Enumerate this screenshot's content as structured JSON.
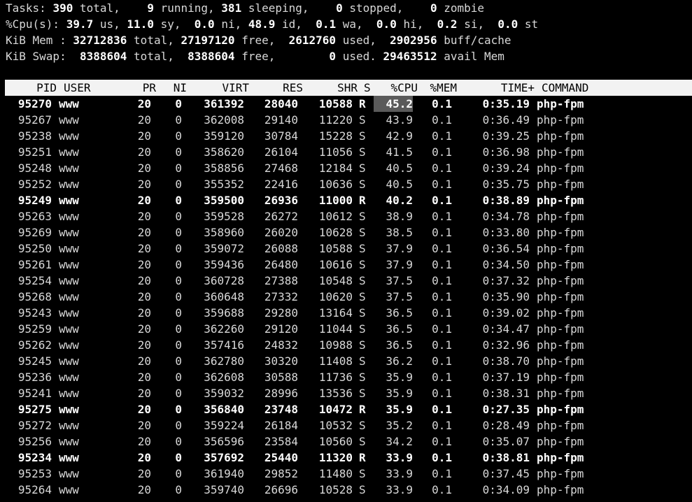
{
  "summary": {
    "tasks": {
      "label": "Tasks:",
      "total": "390",
      "total_label": "total,",
      "running": "9",
      "running_label": "running,",
      "sleeping": "381",
      "sleeping_label": "sleeping,",
      "stopped": "0",
      "stopped_label": "stopped,",
      "zombie": "0",
      "zombie_label": "zombie"
    },
    "cpu": {
      "label": "%Cpu(s):",
      "us": "39.7",
      "us_label": "us,",
      "sy": "11.0",
      "sy_label": "sy,",
      "ni": "0.0",
      "ni_label": "ni,",
      "id": "48.9",
      "id_label": "id,",
      "wa": "0.1",
      "wa_label": "wa,",
      "hi": "0.0",
      "hi_label": "hi,",
      "si": "0.2",
      "si_label": "si,",
      "st": "0.0",
      "st_label": "st"
    },
    "mem": {
      "label": "KiB Mem :",
      "total": "32712836",
      "total_label": "total,",
      "free": "27197120",
      "free_label": "free,",
      "used": "2612760",
      "used_label": "used,",
      "buff": "2902956",
      "buff_label": "buff/cache"
    },
    "swap": {
      "label": "KiB Swap:",
      "total": "8388604",
      "total_label": "total,",
      "free": "8388604",
      "free_label": "free,",
      "used": "0",
      "used_label": "used.",
      "avail": "29463512",
      "avail_label": "avail Mem"
    }
  },
  "columns": [
    "PID",
    "USER",
    "PR",
    "NI",
    "VIRT",
    "RES",
    "SHR",
    "S",
    "%CPU",
    "%MEM",
    "TIME+",
    "COMMAND"
  ],
  "processes": [
    {
      "pid": "95270",
      "user": "www",
      "pr": "20",
      "ni": "0",
      "virt": "361392",
      "res": "28040",
      "shr": "10588",
      "s": "R",
      "cpu": "45.2",
      "mem": "0.1",
      "time": "0:35.19",
      "cmd": "php-fpm",
      "bold": true
    },
    {
      "pid": "95267",
      "user": "www",
      "pr": "20",
      "ni": "0",
      "virt": "362008",
      "res": "29140",
      "shr": "11220",
      "s": "S",
      "cpu": "43.9",
      "mem": "0.1",
      "time": "0:36.49",
      "cmd": "php-fpm",
      "bold": false
    },
    {
      "pid": "95238",
      "user": "www",
      "pr": "20",
      "ni": "0",
      "virt": "359120",
      "res": "30784",
      "shr": "15228",
      "s": "S",
      "cpu": "42.9",
      "mem": "0.1",
      "time": "0:39.25",
      "cmd": "php-fpm",
      "bold": false
    },
    {
      "pid": "95251",
      "user": "www",
      "pr": "20",
      "ni": "0",
      "virt": "358620",
      "res": "26104",
      "shr": "11056",
      "s": "S",
      "cpu": "41.5",
      "mem": "0.1",
      "time": "0:36.98",
      "cmd": "php-fpm",
      "bold": false
    },
    {
      "pid": "95248",
      "user": "www",
      "pr": "20",
      "ni": "0",
      "virt": "358856",
      "res": "27468",
      "shr": "12184",
      "s": "S",
      "cpu": "40.5",
      "mem": "0.1",
      "time": "0:39.24",
      "cmd": "php-fpm",
      "bold": false
    },
    {
      "pid": "95252",
      "user": "www",
      "pr": "20",
      "ni": "0",
      "virt": "355352",
      "res": "22416",
      "shr": "10636",
      "s": "S",
      "cpu": "40.5",
      "mem": "0.1",
      "time": "0:35.75",
      "cmd": "php-fpm",
      "bold": false
    },
    {
      "pid": "95249",
      "user": "www",
      "pr": "20",
      "ni": "0",
      "virt": "359500",
      "res": "26936",
      "shr": "11000",
      "s": "R",
      "cpu": "40.2",
      "mem": "0.1",
      "time": "0:38.89",
      "cmd": "php-fpm",
      "bold": true
    },
    {
      "pid": "95263",
      "user": "www",
      "pr": "20",
      "ni": "0",
      "virt": "359528",
      "res": "26272",
      "shr": "10612",
      "s": "S",
      "cpu": "38.9",
      "mem": "0.1",
      "time": "0:34.78",
      "cmd": "php-fpm",
      "bold": false
    },
    {
      "pid": "95269",
      "user": "www",
      "pr": "20",
      "ni": "0",
      "virt": "358960",
      "res": "26020",
      "shr": "10628",
      "s": "S",
      "cpu": "38.5",
      "mem": "0.1",
      "time": "0:33.80",
      "cmd": "php-fpm",
      "bold": false
    },
    {
      "pid": "95250",
      "user": "www",
      "pr": "20",
      "ni": "0",
      "virt": "359072",
      "res": "26088",
      "shr": "10588",
      "s": "S",
      "cpu": "37.9",
      "mem": "0.1",
      "time": "0:36.54",
      "cmd": "php-fpm",
      "bold": false
    },
    {
      "pid": "95261",
      "user": "www",
      "pr": "20",
      "ni": "0",
      "virt": "359436",
      "res": "26480",
      "shr": "10616",
      "s": "S",
      "cpu": "37.9",
      "mem": "0.1",
      "time": "0:34.50",
      "cmd": "php-fpm",
      "bold": false
    },
    {
      "pid": "95254",
      "user": "www",
      "pr": "20",
      "ni": "0",
      "virt": "360728",
      "res": "27388",
      "shr": "10548",
      "s": "S",
      "cpu": "37.5",
      "mem": "0.1",
      "time": "0:37.32",
      "cmd": "php-fpm",
      "bold": false
    },
    {
      "pid": "95268",
      "user": "www",
      "pr": "20",
      "ni": "0",
      "virt": "360648",
      "res": "27332",
      "shr": "10620",
      "s": "S",
      "cpu": "37.5",
      "mem": "0.1",
      "time": "0:35.90",
      "cmd": "php-fpm",
      "bold": false
    },
    {
      "pid": "95243",
      "user": "www",
      "pr": "20",
      "ni": "0",
      "virt": "359688",
      "res": "29280",
      "shr": "13164",
      "s": "S",
      "cpu": "36.5",
      "mem": "0.1",
      "time": "0:39.02",
      "cmd": "php-fpm",
      "bold": false
    },
    {
      "pid": "95259",
      "user": "www",
      "pr": "20",
      "ni": "0",
      "virt": "362260",
      "res": "29120",
      "shr": "11044",
      "s": "S",
      "cpu": "36.5",
      "mem": "0.1",
      "time": "0:34.47",
      "cmd": "php-fpm",
      "bold": false
    },
    {
      "pid": "95262",
      "user": "www",
      "pr": "20",
      "ni": "0",
      "virt": "357416",
      "res": "24832",
      "shr": "10988",
      "s": "S",
      "cpu": "36.5",
      "mem": "0.1",
      "time": "0:32.96",
      "cmd": "php-fpm",
      "bold": false
    },
    {
      "pid": "95245",
      "user": "www",
      "pr": "20",
      "ni": "0",
      "virt": "362780",
      "res": "30320",
      "shr": "11408",
      "s": "S",
      "cpu": "36.2",
      "mem": "0.1",
      "time": "0:38.70",
      "cmd": "php-fpm",
      "bold": false
    },
    {
      "pid": "95236",
      "user": "www",
      "pr": "20",
      "ni": "0",
      "virt": "362608",
      "res": "30588",
      "shr": "11736",
      "s": "S",
      "cpu": "35.9",
      "mem": "0.1",
      "time": "0:37.19",
      "cmd": "php-fpm",
      "bold": false
    },
    {
      "pid": "95241",
      "user": "www",
      "pr": "20",
      "ni": "0",
      "virt": "359032",
      "res": "28996",
      "shr": "13536",
      "s": "S",
      "cpu": "35.9",
      "mem": "0.1",
      "time": "0:38.31",
      "cmd": "php-fpm",
      "bold": false
    },
    {
      "pid": "95275",
      "user": "www",
      "pr": "20",
      "ni": "0",
      "virt": "356840",
      "res": "23748",
      "shr": "10472",
      "s": "R",
      "cpu": "35.9",
      "mem": "0.1",
      "time": "0:27.35",
      "cmd": "php-fpm",
      "bold": true
    },
    {
      "pid": "95272",
      "user": "www",
      "pr": "20",
      "ni": "0",
      "virt": "359224",
      "res": "26184",
      "shr": "10532",
      "s": "S",
      "cpu": "35.2",
      "mem": "0.1",
      "time": "0:28.49",
      "cmd": "php-fpm",
      "bold": false
    },
    {
      "pid": "95256",
      "user": "www",
      "pr": "20",
      "ni": "0",
      "virt": "356596",
      "res": "23584",
      "shr": "10560",
      "s": "S",
      "cpu": "34.2",
      "mem": "0.1",
      "time": "0:35.07",
      "cmd": "php-fpm",
      "bold": false
    },
    {
      "pid": "95234",
      "user": "www",
      "pr": "20",
      "ni": "0",
      "virt": "357692",
      "res": "25440",
      "shr": "11320",
      "s": "R",
      "cpu": "33.9",
      "mem": "0.1",
      "time": "0:38.81",
      "cmd": "php-fpm",
      "bold": true
    },
    {
      "pid": "95253",
      "user": "www",
      "pr": "20",
      "ni": "0",
      "virt": "361940",
      "res": "29852",
      "shr": "11480",
      "s": "S",
      "cpu": "33.9",
      "mem": "0.1",
      "time": "0:37.45",
      "cmd": "php-fpm",
      "bold": false
    },
    {
      "pid": "95264",
      "user": "www",
      "pr": "20",
      "ni": "0",
      "virt": "359740",
      "res": "26696",
      "shr": "10528",
      "s": "S",
      "cpu": "33.9",
      "mem": "0.1",
      "time": "0:34.09",
      "cmd": "php-fpm",
      "bold": false
    }
  ],
  "highlight_cell": {
    "row": 0,
    "column": "cpu"
  }
}
